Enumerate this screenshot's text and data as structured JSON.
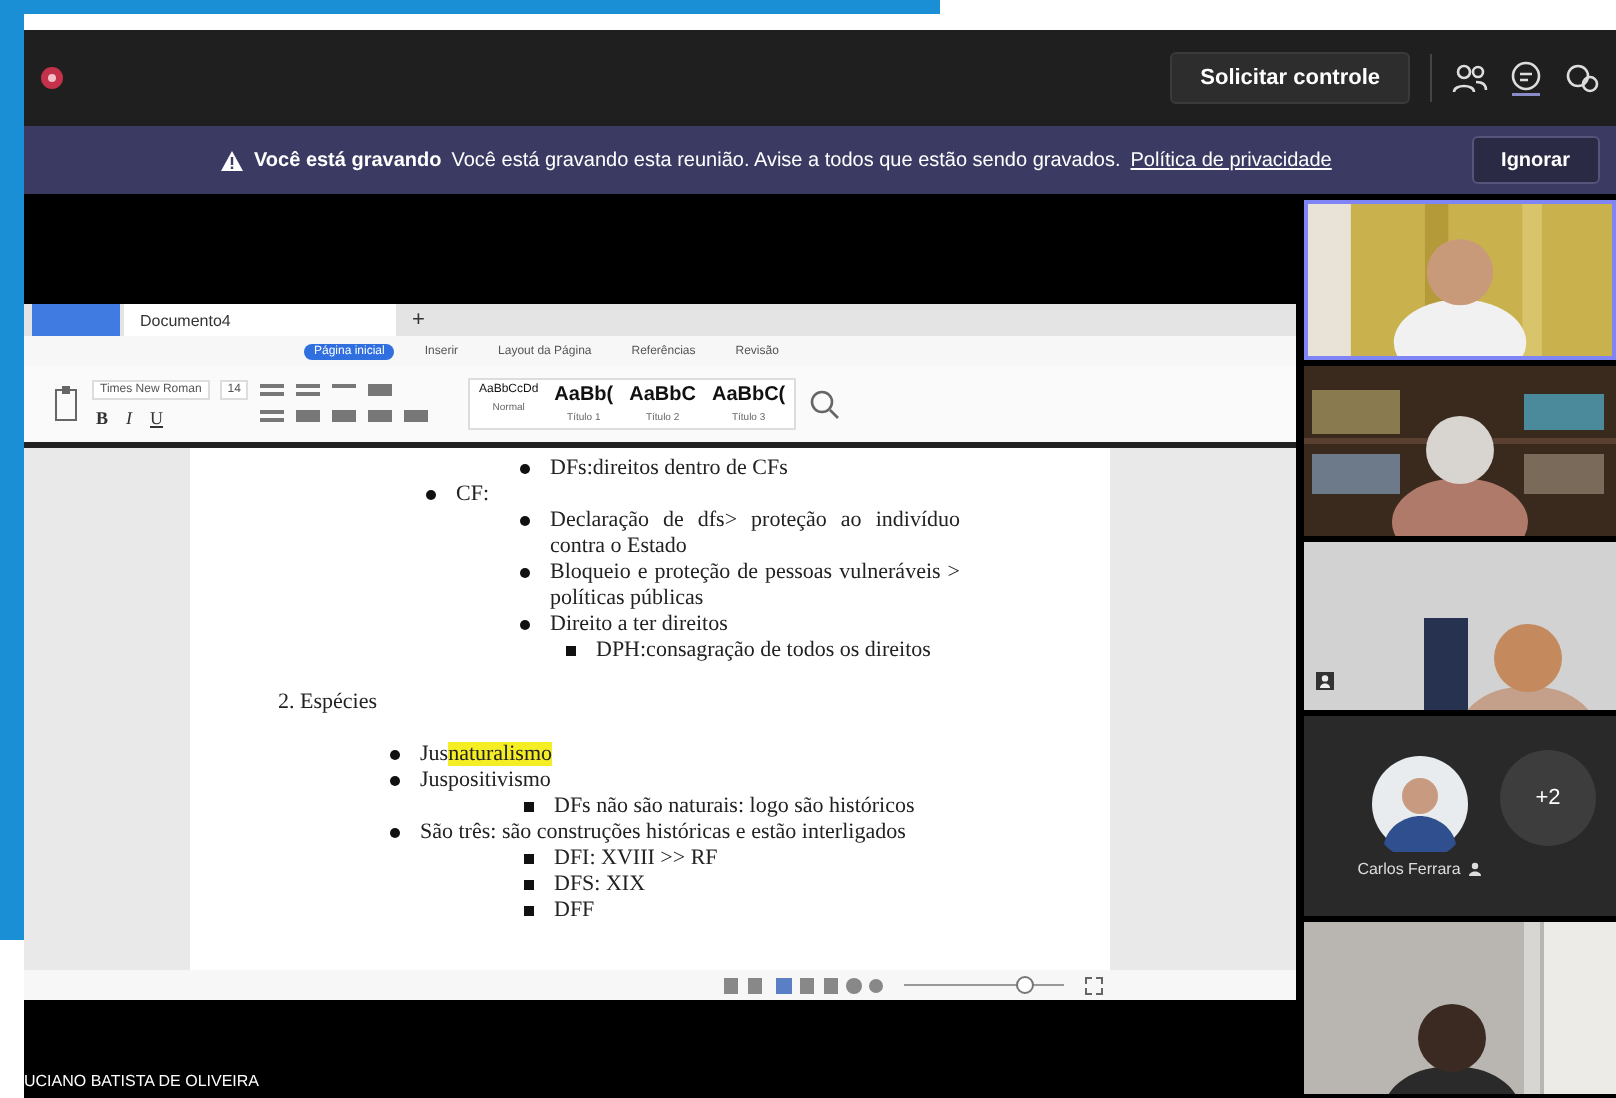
{
  "meeting_bar": {
    "control_button": "Solicitar controle"
  },
  "recording_banner": {
    "title": "Você está gravando",
    "message": "Você está gravando esta reunião. Avise a todos que estão sendo gravados.",
    "link": "Política de privacidade",
    "dismiss": "Ignorar"
  },
  "shared_doc": {
    "tabs": [
      {
        "label": "Documento4",
        "selected": true
      }
    ],
    "new_tab": "+",
    "menu_tabs": [
      {
        "label": "Página inicial",
        "selected": true
      },
      {
        "label": "Inserir",
        "selected": false
      },
      {
        "label": "Layout da Página",
        "selected": false
      },
      {
        "label": "Referências",
        "selected": false
      },
      {
        "label": "Revisão",
        "selected": false
      }
    ],
    "font": "Times New Roman",
    "font_size": "14",
    "format_buttons": [
      "B",
      "I",
      "U"
    ],
    "styles": [
      {
        "sample": "AaBbCcDd",
        "name": "Normal"
      },
      {
        "sample": "AaBb(",
        "name": "Título 1"
      },
      {
        "sample": "AaBbC",
        "name": "Título 2"
      },
      {
        "sample": "AaBbC(",
        "name": "Título 3"
      }
    ],
    "outline_1": [
      {
        "children": [
          {
            "text": "DFs:direitos dentro de CFs"
          }
        ]
      },
      {
        "text": "CF:",
        "children": [
          {
            "text": "Declaração de dfs> proteção ao indivíduo contra o Estado"
          },
          {
            "text": "Bloqueio e proteção de pessoas vulneráveis > políticas públicas"
          },
          {
            "text": "Direito a ter direitos",
            "children": [
              {
                "text": "DPH:consagração de todos os direitos"
              }
            ]
          }
        ]
      }
    ],
    "heading": "2. Espécies",
    "outline_2": [
      {
        "segments": [
          {
            "text": "Jus",
            "highlighted": false
          },
          {
            "text": "naturalismo",
            "highlighted": true
          }
        ]
      },
      {
        "text": "Juspositivismo",
        "children": [
          {
            "text": "DFs não são naturais: logo são históricos"
          }
        ]
      },
      {
        "text": "São três: são construções históricas e estão interligados",
        "children": [
          {
            "text": "DFI: XVIII >> RF"
          },
          {
            "text": "DFS: XIX"
          },
          {
            "text": "DFF"
          }
        ]
      }
    ],
    "zoom_slider": {
      "level": 0.75
    }
  },
  "presenter_name": "UCIANO BATISTA DE OLIVEIRA",
  "participants": [
    {
      "kind": "video",
      "speaking": true,
      "badge": false
    },
    {
      "kind": "video",
      "speaking": false,
      "badge": false
    },
    {
      "kind": "video",
      "speaking": false,
      "badge": true
    },
    {
      "kind": "avatars",
      "name": "Carlos Ferrara",
      "overflow": "+2"
    },
    {
      "kind": "video",
      "speaking": false,
      "badge": false
    }
  ]
}
